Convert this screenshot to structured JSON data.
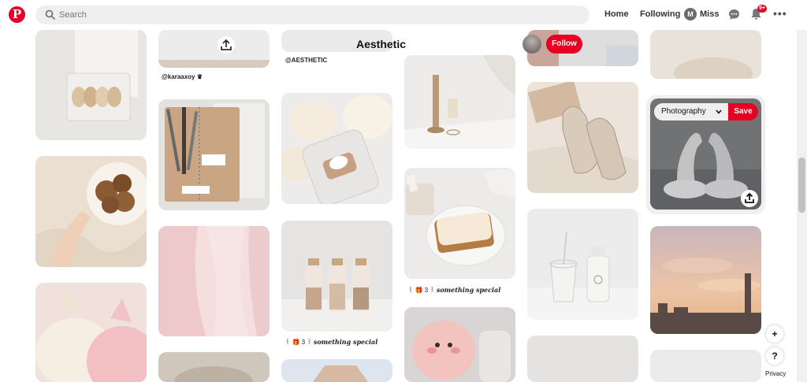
{
  "header": {
    "logo_letter": "P",
    "search_placeholder": "Search",
    "nav_home": "Home",
    "nav_following": "Following",
    "avatar_letter": "M",
    "user_name": "Miss",
    "notification_badge": "9+",
    "more": "•••"
  },
  "board": {
    "title": "Aesthetic",
    "follow_label": "Follow"
  },
  "pins": {
    "caption_karaaxoy": "@karaaxoy ♛",
    "caption_aesthetic": "@AESTHETIC",
    "caption_something_1_prefix": "꒰ 🎁 3 ꒱",
    "caption_something_1": "something special",
    "caption_something_2_prefix": "꒰ 🎁 3 ꒱",
    "caption_something_2": "something special"
  },
  "hover_pin": {
    "board_select": "Photography",
    "save_label": "Save"
  },
  "floating": {
    "add": "+",
    "help": "?",
    "privacy": "Privacy"
  },
  "colors": {
    "brand_red": "#e60023",
    "search_bg": "#efefef"
  }
}
